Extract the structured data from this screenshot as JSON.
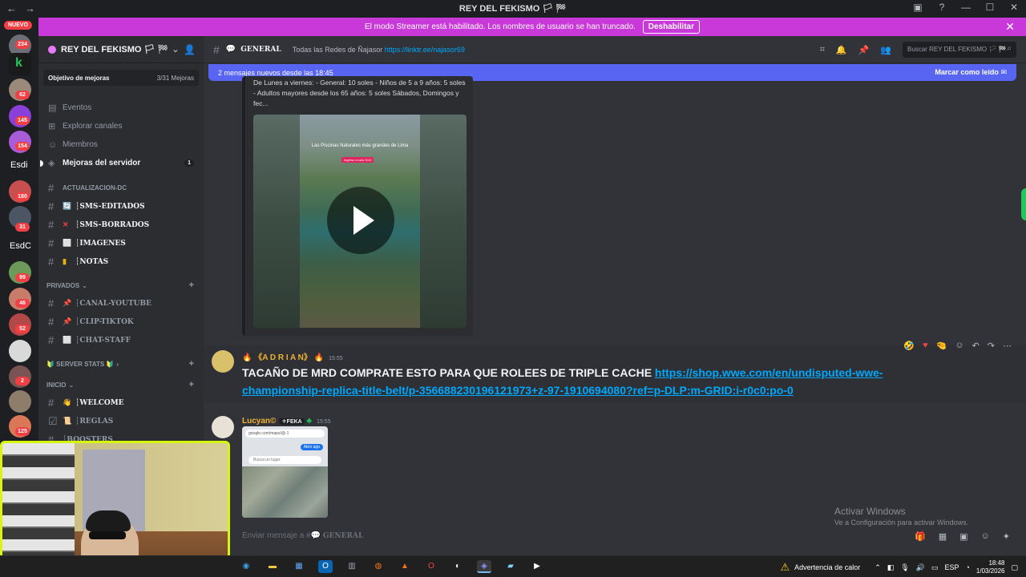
{
  "window": {
    "title": "REY DEL FEKISMO 🏳 🏁",
    "controls": [
      "▣",
      "?",
      "—",
      "☐",
      "✕"
    ]
  },
  "banner": {
    "text": "El modo Streamer está habilitado. Los nombres de usuario se han truncado.",
    "button": "Deshabilitar"
  },
  "guilds": {
    "nuevo": "NUEVO",
    "badges": [
      "234",
      "62",
      "145",
      "154",
      "180",
      "31",
      "99",
      "46",
      "52",
      "2",
      "125"
    ],
    "labels": [
      "Esdi",
      "EsdC"
    ]
  },
  "server": {
    "name": "REY DEL FEKISMO 🏳 🏁",
    "boost_goal": "Objetivo de mejoras",
    "boost_count": "3/31 Mejoras",
    "items": [
      {
        "label": "Eventos",
        "icon": "calendar-icon"
      },
      {
        "label": "Explorar canales",
        "icon": "browse-icon"
      },
      {
        "label": "Miembros",
        "icon": "members-icon"
      },
      {
        "label": "Mejoras del servidor",
        "icon": "boost-icon",
        "count": "1"
      }
    ]
  },
  "channels": {
    "cat1": "ACTUALIZACION-DC",
    "c1": "┆SMS-EDITADOS",
    "c2": "┆SMS-BORRADOS",
    "c3": "┆IMAGENES",
    "c4": "┆NOTAS",
    "cat2": "PRIVADOS",
    "c5": "┆CANAL-YOUTUBE",
    "c6": "┆CLIP-TIKTOK",
    "c7": "┆CHAT-STAFF",
    "cat3": "🔰 SERVER STATS 🔰",
    "cat4": "INICIO",
    "c8": "┆WELCOME",
    "c9": "┆REGLAS",
    "c10": "┆BOOSTERS"
  },
  "header": {
    "channel": "GENERAL",
    "topic_text": "Todas las Redes de Ñajasor",
    "topic_link": "https://linktr.ee/najasor69",
    "search_placeholder": "Buscar REY DEL FEKISMO 🏳 🏁"
  },
  "newbar": {
    "left": "2 mensajes nuevos desde las 18:45",
    "right": "Marcar como leído"
  },
  "embed": {
    "desc": "De Lunes a viernes: - General: 10 soles - Niños de 5 a 9 años: 5 soles - Adultos mayores desde los 65 años: 5 soles Sábados, Domingos y fec...",
    "video_caption": "Las Piscinas Naturales más grandes de Lima",
    "video_tag": "Ingreso a solo S/10"
  },
  "messages": [
    {
      "author": "🔥 《A D R I A N》 🔥",
      "time": "15:55",
      "text": "TACAÑO DE MRD COMPRATE ESTO PARA QUE ROLEES DE TRIPLE CACHE ",
      "link": "https://shop.wwe.com/en/undisputed-wwe-championship-replica-title-belt/p-356688230196121973+z-97-1910694080?ref=p-DLP:m-GRID:i-r0c0:po-0",
      "author_color": "#f0b232"
    },
    {
      "author": "Lucyan©",
      "tag": "⚜FEKA",
      "time": "15:55",
      "author_color": "#f0b232",
      "thumb_url": "google.com/maps/@-1",
      "thumb_btn": "Abrir app",
      "thumb_search": "Busca un lugar"
    }
  ],
  "composer": {
    "placeholder": "Enviar mensaje a #",
    "channel": "GENERAL"
  },
  "watermark": {
    "line1": "Activar Windows",
    "line2": "Ve a Configuración para activar Windows."
  },
  "taskbar": {
    "weather": "Advertencia de calor",
    "lang": "ESP",
    "time": "18:48",
    "date": "1/03/2026"
  },
  "colors": {
    "accent": "#5865f2",
    "banner": "#c938d8",
    "link": "#00a8fc",
    "webcam_border": "#d7f60d"
  }
}
